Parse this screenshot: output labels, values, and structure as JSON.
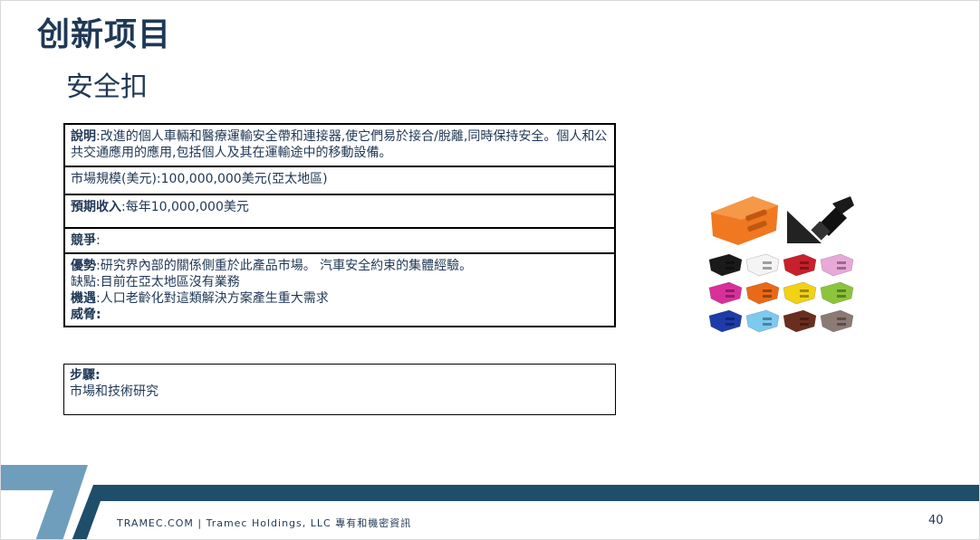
{
  "header": {
    "title": "创新项目",
    "subtitle": "安全扣"
  },
  "table": {
    "description": {
      "label": "說明",
      "text": ":改進的個人車輛和醫療運輸安全帶和連接器,使它們易於接合/脫離,同時保持安全。個人和公共交通應用的應用,包括個人及其在運輸途中的移動設備。"
    },
    "market": {
      "text": "市場規模(美元):100,000,000美元(亞太地區)"
    },
    "revenue": {
      "label": "預期收入",
      "text": ":每年10,000,000美元"
    },
    "competition": {
      "label": "競爭",
      "text": ":"
    },
    "swot": {
      "strengths_label": "優勢",
      "strengths_text": ":研究界內部的關係側重於此產品市場。 汽車安全約束的集體經驗。",
      "weaknesses_text": "缺點:目前在亞太地區沒有業務",
      "opportunities_label": "機遇",
      "opportunities_text": ":人口老齡化對這類解決方案產生重大需求",
      "threats_label": "威脅",
      "threats_text": ":"
    }
  },
  "steps": {
    "label": "步驟",
    "label_suffix": ":",
    "text": "市場和技術研究"
  },
  "footer": {
    "text": "TRAMEC.COM  |  Tramec Holdings, LLC 專有和機密資訊",
    "page_number": "40"
  },
  "buckles": [
    {
      "name": "buckle-black",
      "color": "#1a1a1a"
    },
    {
      "name": "buckle-white",
      "color": "#f4f4f4"
    },
    {
      "name": "buckle-red",
      "color": "#c8202c"
    },
    {
      "name": "buckle-pink",
      "color": "#e8a8d8"
    },
    {
      "name": "buckle-magenta",
      "color": "#d8309a"
    },
    {
      "name": "buckle-orange",
      "color": "#e86a18"
    },
    {
      "name": "buckle-yellow",
      "color": "#f2d214"
    },
    {
      "name": "buckle-green",
      "color": "#8cc43c"
    },
    {
      "name": "buckle-blue",
      "color": "#1e3ca8"
    },
    {
      "name": "buckle-light-blue",
      "color": "#7ccaf0"
    },
    {
      "name": "buckle-brown",
      "color": "#6a2e1e"
    },
    {
      "name": "buckle-taupe",
      "color": "#8c7a74"
    }
  ],
  "colors": {
    "text": "#1f3856",
    "footer_dark": "#1f4e6a",
    "footer_light": "#6f9ebd",
    "large_buckle": "#f07820"
  }
}
